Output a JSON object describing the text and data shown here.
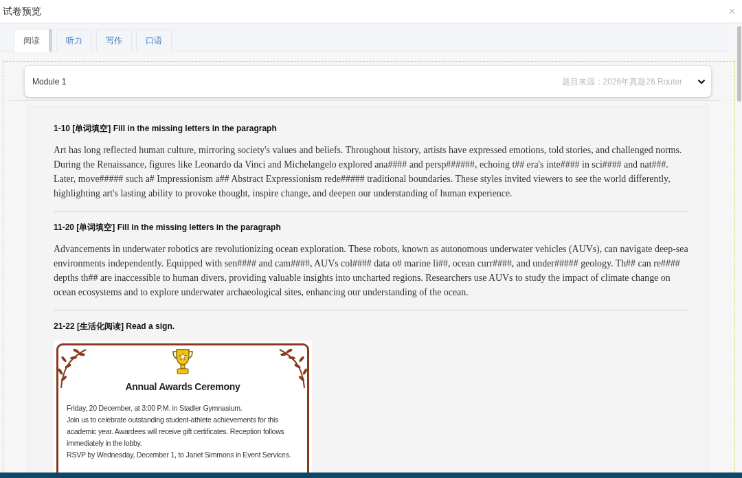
{
  "window": {
    "title": "试卷预览",
    "close": "×"
  },
  "tabs": [
    {
      "label": "阅读",
      "selected": true
    },
    {
      "label": "听力",
      "selected": false
    },
    {
      "label": "写作",
      "selected": false
    },
    {
      "label": "口语",
      "selected": false
    }
  ],
  "module": {
    "title": "Module 1",
    "source": "题目来源：2026年真题26 Router"
  },
  "questions": [
    {
      "kind": "passage",
      "heading": "1-10 [单词填空] Fill in the missing letters in the paragraph",
      "text": "Art has long reflected human culture, mirroring society's values and beliefs. Throughout history, artists have expressed emotions, told stories, and challenged norms. During the Renaissance, figures like Leonardo da Vinci and Michelangelo explored ana#### and persp######, echoing t## era's inte#### in sci#### and nat###. Later, move##### such a# Impressionism a## Abstract Expressionism rede##### traditional boundaries. These styles invited viewers to see the world differently, highlighting art's lasting ability to provoke thought, inspire change, and deepen our understanding of human experience."
    },
    {
      "kind": "passage",
      "heading": "11-20 [单词填空] Fill in the missing letters in the paragraph",
      "text": "Advancements in underwater robotics are revolutionizing ocean exploration. These robots, known as autonomous underwater vehicles (AUVs), can navigate deep-sea environments independently. Equipped with sen#### and cam####, AUVs col#### data o# marine li##, ocean curr####, and under##### geology. Th## can re#### depths th## are inaccessible to human divers, providing valuable insights into uncharted regions. Researchers use AUVs to study the impact of climate change on ocean ecosystems and to explore underwater archaeological sites, enhancing our understanding of the ocean."
    },
    {
      "kind": "sign",
      "heading": "21-22 [生活化阅读] Read a sign.",
      "sign": {
        "title": "Annual Awards Ceremony",
        "lines": [
          "Friday, 20 December, at 3:00 P.M. in Stadler Gymnasium.",
          "Join us to celebrate outstanding student-athlete achievements for this academic year. Awardees will receive gift certificates. Reception follows immediately in the lobby.",
          "RSVP by Wednesday, December 1, to Janet Simmons in Event Services."
        ]
      }
    }
  ]
}
